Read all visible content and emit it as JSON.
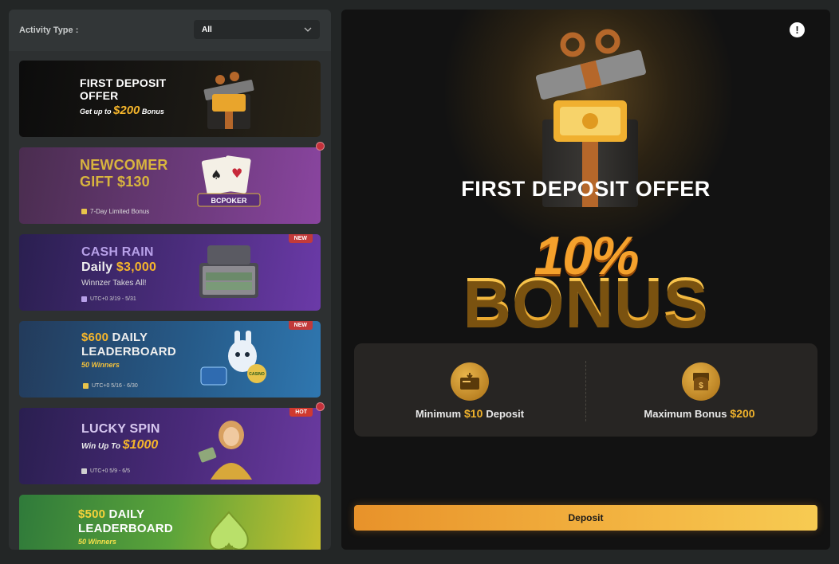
{
  "filter": {
    "label": "Activity Type :",
    "value": "All"
  },
  "cards": [
    {
      "title1": "FIRST DEPOSIT",
      "title2": "OFFER",
      "sub_prefix": "Get up to",
      "sub_amount": "$200",
      "sub_suffix": "Bonus"
    },
    {
      "title1": "NEWCOMER",
      "title2": "GIFT $130",
      "foot": "7-Day Limited Bonus",
      "art_label": "BCPOKER"
    },
    {
      "badge": "NEW",
      "title1": "CASH RAIN",
      "title2_prefix": "Daily",
      "title2_amount": "$3,000",
      "sub": "Winnzer Takes All!",
      "foot": "UTC+0 3/19 - 5/31"
    },
    {
      "badge": "NEW",
      "title1_amount": "$600",
      "title1_rest": "DAILY",
      "title2": "LEADERBOARD",
      "sub": "50 Winners",
      "foot": "UTC+0 5/16 - 6/30",
      "art_label": "CASINO"
    },
    {
      "badge": "HOT",
      "title1": "LUCKY SPIN",
      "sub_prefix": "Win Up To",
      "sub_amount": "$1000",
      "foot": "UTC+0 5/9 - 6/5"
    },
    {
      "title1_amount": "$500",
      "title1_rest": "DAILY",
      "title2": "LEADERBOARD",
      "sub": "50 Winners"
    }
  ],
  "detail": {
    "title": "FIRST DEPOSIT OFFER",
    "percent": "10%",
    "bonus": "BONUS",
    "min_label": "Minimum",
    "min_value": "$10",
    "min_suffix": "Deposit",
    "max_label": "Maximum Bonus",
    "max_value": "$200",
    "button": "Deposit",
    "info_glyph": "!"
  },
  "colors": {
    "accent": "#f1b32c",
    "button": "#f3b441",
    "badge": "#c23a3a"
  }
}
